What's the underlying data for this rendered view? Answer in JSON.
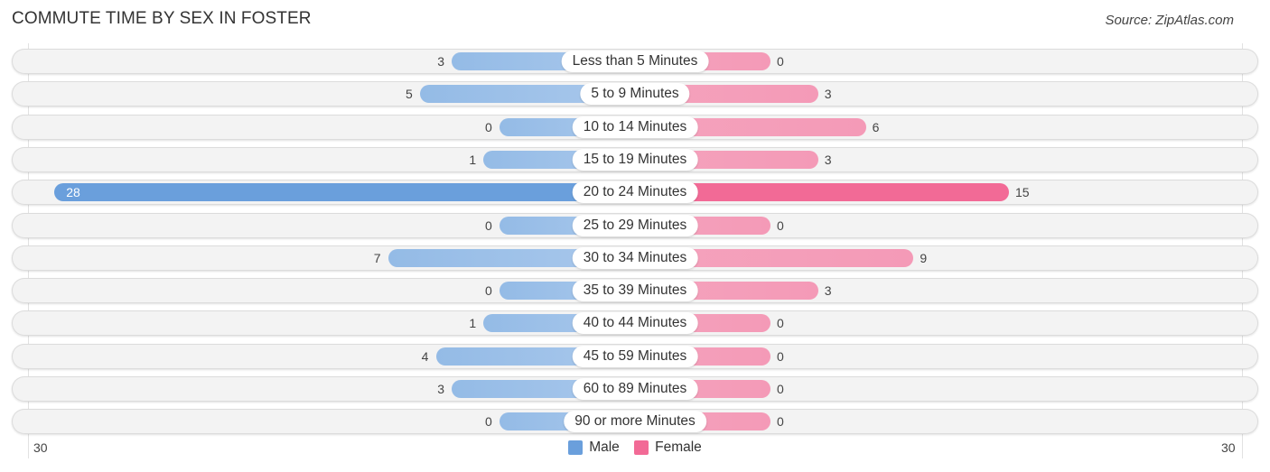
{
  "header": {
    "title": "COMMUTE TIME BY SEX IN FOSTER",
    "source": "Source: ZipAtlas.com"
  },
  "colors": {
    "male": "#6a9fdc",
    "female": "#f26a96",
    "male_light": "#a9c8ec",
    "female_light": "#f5a3bd"
  },
  "chart_data": {
    "type": "bar",
    "orientation": "horizontal-diverging",
    "title": "COMMUTE TIME BY SEX IN FOSTER",
    "categories": [
      "Less than 5 Minutes",
      "5 to 9 Minutes",
      "10 to 14 Minutes",
      "15 to 19 Minutes",
      "20 to 24 Minutes",
      "25 to 29 Minutes",
      "30 to 34 Minutes",
      "35 to 39 Minutes",
      "40 to 44 Minutes",
      "45 to 59 Minutes",
      "60 to 89 Minutes",
      "90 or more Minutes"
    ],
    "series": [
      {
        "name": "Male",
        "values": [
          3,
          5,
          0,
          1,
          28,
          0,
          7,
          0,
          1,
          4,
          3,
          0
        ]
      },
      {
        "name": "Female",
        "values": [
          0,
          3,
          6,
          3,
          15,
          0,
          9,
          3,
          0,
          0,
          0,
          0
        ]
      }
    ],
    "axis": {
      "left_tick": "30",
      "right_tick": "30",
      "range": [
        -30,
        30
      ]
    },
    "legend": {
      "position": "bottom-center",
      "entries": [
        "Male",
        "Female"
      ]
    },
    "xlabel": "",
    "ylabel": ""
  }
}
